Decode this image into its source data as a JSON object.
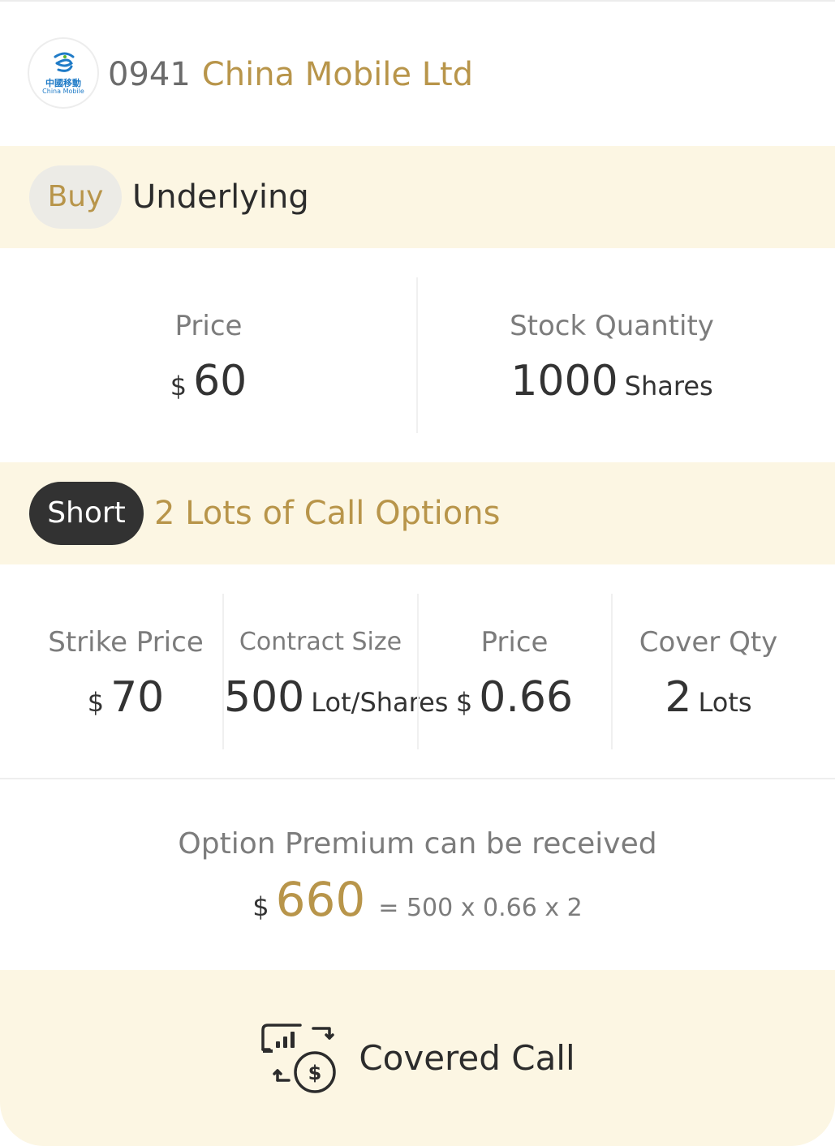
{
  "header": {
    "logo_cn": "中國移動",
    "logo_en": "China Mobile",
    "stock_code": "0941",
    "stock_name": "China Mobile Ltd"
  },
  "underlying": {
    "action": "Buy",
    "title": "Underlying",
    "price": {
      "label": "Price",
      "currency": "$",
      "value": "60"
    },
    "quantity": {
      "label": "Stock Quantity",
      "value": "1000",
      "unit": "Shares"
    }
  },
  "options": {
    "action": "Short",
    "title": "2 Lots of Call Options",
    "strike": {
      "label": "Strike Price",
      "currency": "$",
      "value": "70"
    },
    "contract_size": {
      "label": "Contract Size",
      "value": "500",
      "unit": "Lot/Shares"
    },
    "price": {
      "label": "Price",
      "currency": "$",
      "value": "0.66"
    },
    "cover_qty": {
      "label": "Cover Qty",
      "value": "2",
      "unit": "Lots"
    }
  },
  "premium": {
    "label": "Option Premium can be received",
    "currency": "$",
    "value": "660",
    "formula": "= 500 x 0.66 x 2"
  },
  "strategy": {
    "icon": "covered-call-icon",
    "label": "Covered Call"
  },
  "colors": {
    "accent_gold": "#b8954a",
    "band_bg": "#fcf6e3",
    "dark_pill": "#323232"
  }
}
